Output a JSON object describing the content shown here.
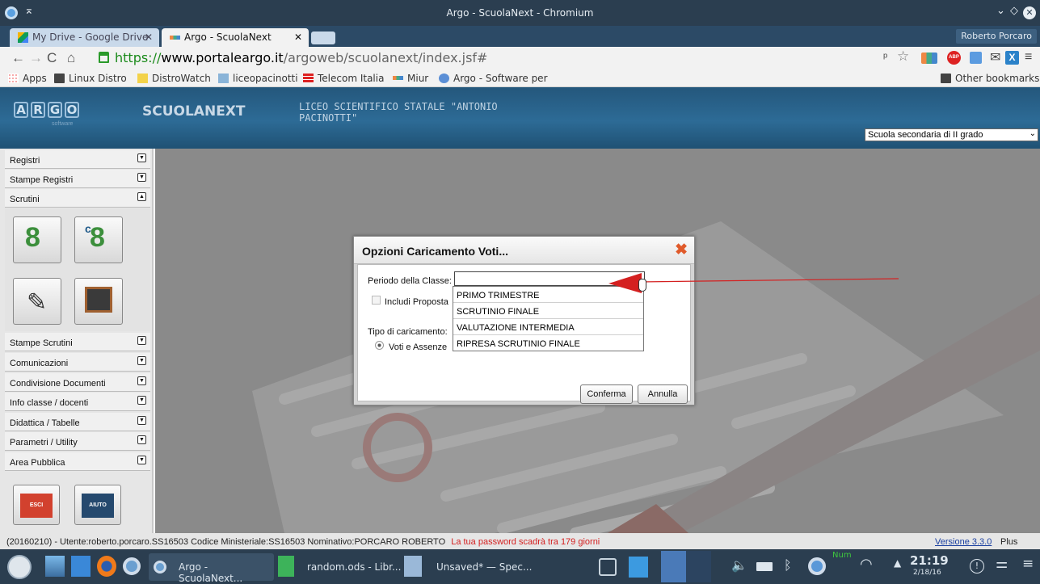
{
  "window": {
    "title": "Argo - ScuolaNext - Chromium"
  },
  "tabs": [
    {
      "label": "My Drive - Google Drive"
    },
    {
      "label": "Argo - ScuolaNext"
    }
  ],
  "profile": "Roberto Porcaro",
  "url": {
    "scheme": "https://",
    "host": "www.portaleargo.it",
    "path": "/argoweb/scuolanext/index.jsf#"
  },
  "bookmarks": [
    "Apps",
    "Linux Distro",
    "DistroWatch",
    "liceopacinotti",
    "Telecom Italia",
    "Miur",
    "Argo - Software per",
    "Other bookmarks"
  ],
  "header": {
    "logo_letters": [
      "A",
      "R",
      "G",
      "O"
    ],
    "logo_sub": "software",
    "brand": "SCUOLANEXT",
    "school": "LICEO SCIENTIFICO STATALE \"ANTONIO PACINOTTI\"",
    "school_type": "Scuola secondaria di II grado"
  },
  "sidebar": {
    "top_items": [
      "Registri",
      "Stampe Registri",
      "Scrutini"
    ],
    "bottom_items": [
      "Stampe Scrutini",
      "Comunicazioni",
      "Condivisione Documenti",
      "Info classe / docenti",
      "Didattica / Tabelle",
      "Parametri / Utility",
      "Area Pubblica"
    ],
    "btn_esci": "ESCI",
    "btn_aiuto": "AIUTO"
  },
  "dialog": {
    "title": "Opzioni Caricamento Voti...",
    "periodo_label": "Periodo della Classe:",
    "includi_label": "Includi Proposta",
    "tipo_label": "Tipo di caricamento:",
    "radio_label": "Voti e Assenze",
    "confirm": "Conferma",
    "cancel": "Annulla",
    "options": [
      "PRIMO TRIMESTRE",
      "SCRUTINIO FINALE",
      "VALUTAZIONE INTERMEDIA",
      "RIPRESA SCRUTINIO FINALE"
    ]
  },
  "status": {
    "info": "(20160210) - Utente:roberto.porcaro.SS16503 Codice Ministeriale:SS16503 Nominativo:PORCARO ROBERTO",
    "warning": "La tua password scadrà tra 179 giorni",
    "version": "Versione 3.3.0",
    "version_suffix": "Plus"
  },
  "taskbar": {
    "apps": [
      "Argo - ScuolaNext...",
      "random.ods - Libr...",
      "Unsaved* — Spec..."
    ],
    "num": "Num",
    "time": "21:19",
    "date": "2/18/16"
  },
  "colors": {
    "accent_red": "#e02020",
    "header_blue": "#2d6b96",
    "taskbar": "#2b3e50"
  }
}
